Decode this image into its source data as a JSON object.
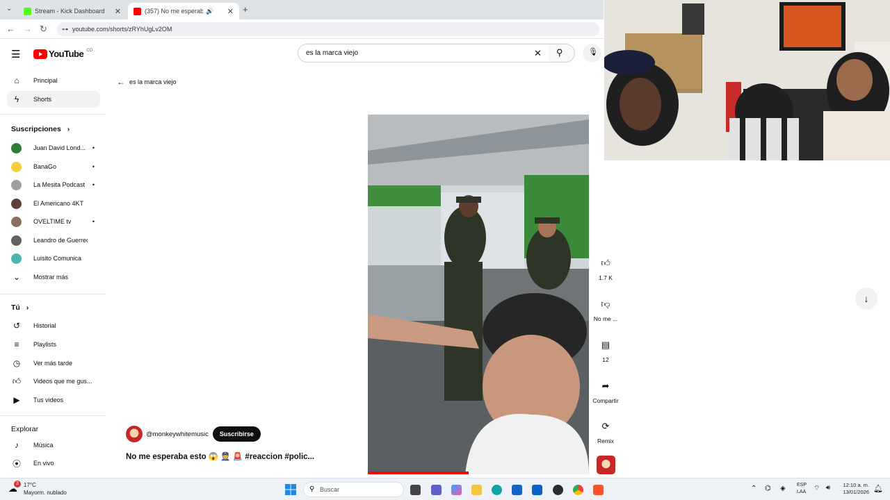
{
  "browser": {
    "tabs": [
      {
        "title": "Stream - Kick Dashboard",
        "active": false
      },
      {
        "title": "(357) No me esperaba esto",
        "active": true
      }
    ],
    "new_tab": "+",
    "url": "youtube.com/shorts/zRYhUgLv2OM"
  },
  "header": {
    "logo_text": "YouTube",
    "country": "CO",
    "search_value": "es la marca viejo"
  },
  "sidebar": {
    "main": [
      {
        "label": "Principal",
        "icon": "home-icon"
      },
      {
        "label": "Shorts",
        "icon": "shorts-icon"
      }
    ],
    "subscriptions_title": "Suscripciones",
    "subscriptions": [
      {
        "label": "Juan David Lond...",
        "color": "#2e7d32",
        "dot": true
      },
      {
        "label": "BanaGo",
        "color": "#f4d03f",
        "dot": true
      },
      {
        "label": "La Mesita Podcast",
        "color": "#9e9e9e",
        "dot": true
      },
      {
        "label": "El Americano 4KT",
        "color": "#5d4037",
        "dot": false
      },
      {
        "label": "OVELTIME tv",
        "color": "#8d6e63",
        "dot": true
      },
      {
        "label": "Leandro de Guerreo",
        "color": "#616161",
        "dot": false
      },
      {
        "label": "Luisito Comunica",
        "color": "#4db6ac",
        "dot": false
      }
    ],
    "show_more": "Mostrar más",
    "you_title": "Tú",
    "you_items": [
      {
        "label": "Historial",
        "icon": "history-icon"
      },
      {
        "label": "Playlists",
        "icon": "playlist-icon"
      },
      {
        "label": "Ver más tarde",
        "icon": "clock-icon"
      },
      {
        "label": "Videos que me gus...",
        "icon": "thumb-up-icon"
      },
      {
        "label": "Tus videos",
        "icon": "video-icon"
      }
    ],
    "explore_title": "Explorar",
    "explore_items": [
      {
        "label": "Música",
        "icon": "music-icon"
      },
      {
        "label": "En vivo",
        "icon": "live-icon"
      }
    ]
  },
  "main": {
    "back_label": "es la marca viejo",
    "channel": "@monkeywhitemusic",
    "subscribe": "Suscribirse",
    "video_title": "No me esperaba esto 😱 👮 🚨 #reaccion #polic..."
  },
  "actions": [
    {
      "label": "1.7 K",
      "icon": "like-icon"
    },
    {
      "label": "No me ...",
      "icon": "dislike-icon"
    },
    {
      "label": "12",
      "icon": "comment-icon"
    },
    {
      "label": "Compartir",
      "icon": "share-icon"
    },
    {
      "label": "Remix",
      "icon": "remix-icon"
    }
  ],
  "taskbar": {
    "weather_temp": "17°C",
    "weather_desc": "Mayorm. nublado",
    "search_placeholder": "Buscar",
    "lang_top": "ESP",
    "lang_bottom": "LAA",
    "time": "12:10 a. m.",
    "date": "13/01/2026",
    "badge": "3"
  }
}
